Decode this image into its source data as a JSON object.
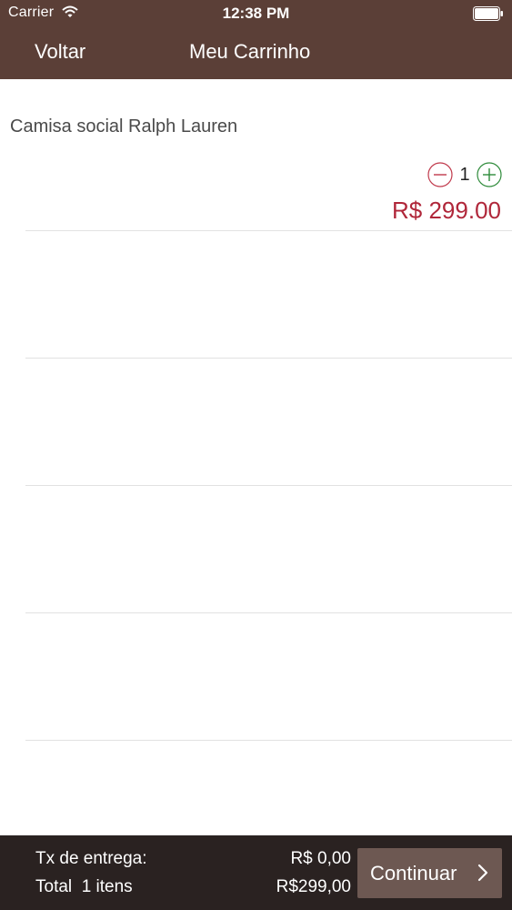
{
  "status_bar": {
    "carrier": "Carrier",
    "time": "12:38 PM"
  },
  "nav": {
    "back_label": "Voltar",
    "title": "Meu Carrinho"
  },
  "cart": {
    "items": [
      {
        "name": "Camisa social Ralph Lauren",
        "quantity": "1",
        "price": "R$ 299.00"
      }
    ]
  },
  "footer": {
    "delivery_label": "Tx de entrega:",
    "delivery_value": "R$ 0,00",
    "total_label": "Total  1 itens",
    "total_value": "R$299,00",
    "continue_label": "Continuar"
  },
  "colors": {
    "header_bg": "#5b3f37",
    "footer_bg": "#2a2221",
    "button_bg": "#6d5852",
    "price": "#b0273a",
    "minus": "#c0394b",
    "plus": "#2e8b3a"
  },
  "icons": [
    "wifi-icon",
    "battery-icon",
    "minus-circle-icon",
    "plus-circle-icon",
    "chevron-right-icon"
  ]
}
